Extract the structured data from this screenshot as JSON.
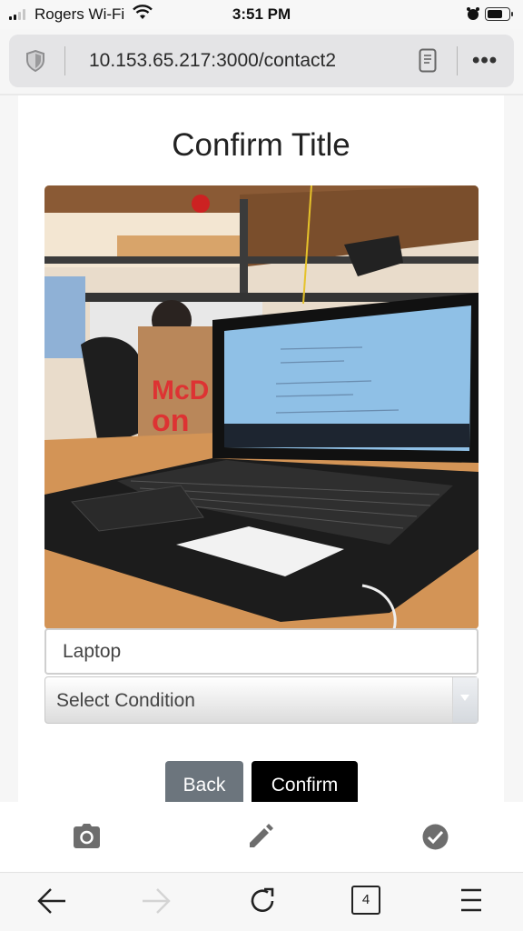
{
  "status_bar": {
    "carrier": "Rogers Wi-Fi",
    "time": "3:51 PM",
    "signal_bars_active": 2,
    "signal_bars_total": 4,
    "battery_level": 0.6
  },
  "browser": {
    "url": "10.153.65.217:3000/contact2",
    "more_label": "•••",
    "tab_count": "4"
  },
  "page": {
    "title": "Confirm Title",
    "photo_alt": "Laptop on a wooden desk in an office",
    "title_input_value": "Laptop",
    "condition_select_value": "Select Condition",
    "back_label": "Back",
    "confirm_label": "Confirm"
  },
  "toolbar": {
    "items": [
      {
        "icon": "camera-icon"
      },
      {
        "icon": "pencil-icon"
      },
      {
        "icon": "check-circle-icon"
      }
    ]
  },
  "colors": {
    "back_button": "#6c757d",
    "confirm_button": "#000000",
    "toolbar_icon": "#6d6d6d"
  }
}
